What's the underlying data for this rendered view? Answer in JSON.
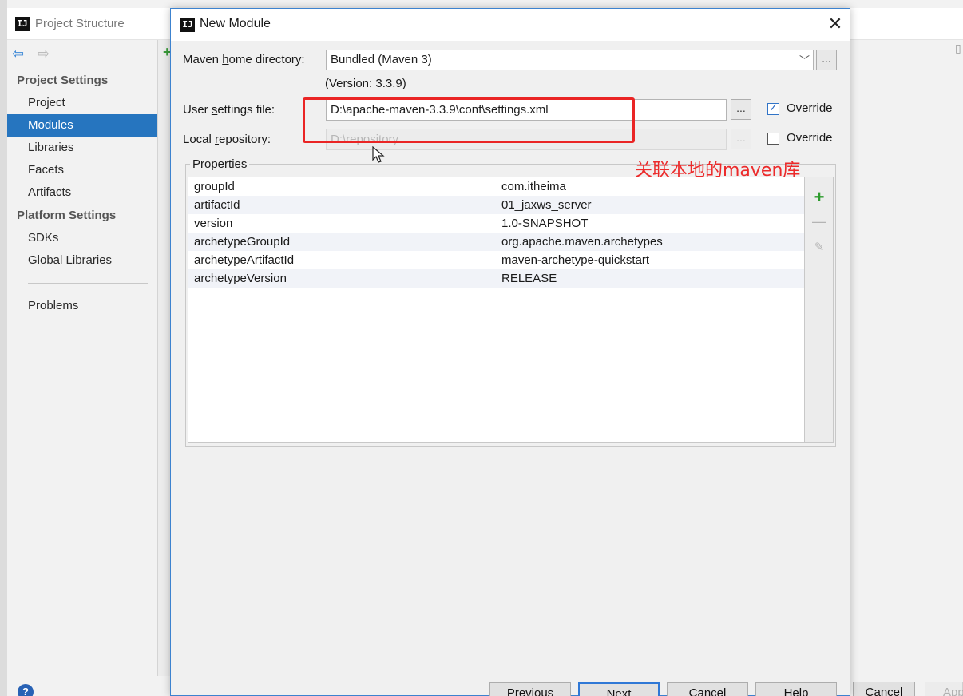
{
  "background_window": {
    "title": "Project Structure",
    "sidebar": {
      "section_project": "Project Settings",
      "project_items": [
        "Project",
        "Modules",
        "Libraries",
        "Facets",
        "Artifacts"
      ],
      "selected": "Modules",
      "section_platform": "Platform Settings",
      "platform_items": [
        "SDKs",
        "Global Libraries"
      ],
      "problems": "Problems"
    },
    "help_glyph": "?",
    "footer_buttons": {
      "cancel": "Cancel",
      "apply": "Apply"
    }
  },
  "dialog": {
    "title": "New Module",
    "maven_home": {
      "label_pre": "Maven ",
      "label_mnemonic": "h",
      "label_post": "ome directory:",
      "value": "Bundled (Maven 3)",
      "version_note": "(Version: 3.3.9)"
    },
    "user_settings": {
      "label_pre": "User ",
      "label_mnemonic": "s",
      "label_post": "ettings file:",
      "value": "D:\\apache-maven-3.3.9\\conf\\settings.xml",
      "override_label": "Override",
      "override_checked": true
    },
    "local_repository": {
      "label_pre": "Local ",
      "label_mnemonic": "r",
      "label_post": "epository:",
      "value": "D:\\repository",
      "override_label": "Override",
      "override_checked": false
    },
    "browse_label": "...",
    "properties": {
      "title": "Properties",
      "rows": [
        {
          "key": "groupId",
          "value": "com.itheima"
        },
        {
          "key": "artifactId",
          "value": "01_jaxws_server"
        },
        {
          "key": "version",
          "value": "1.0-SNAPSHOT"
        },
        {
          "key": "archetypeGroupId",
          "value": "org.apache.maven.archetypes"
        },
        {
          "key": "archetypeArtifactId",
          "value": "maven-archetype-quickstart"
        },
        {
          "key": "archetypeVersion",
          "value": "RELEASE"
        }
      ],
      "tools": {
        "add": "+",
        "remove": "—",
        "edit": "✎"
      }
    },
    "annotation_text": "关联本地的maven库",
    "buttons": {
      "previous": "Previous",
      "next": "Next",
      "cancel": "Cancel",
      "help": "Help"
    }
  },
  "colors": {
    "accent": "#2675bf",
    "annotation_red": "#ea2525",
    "add_green": "#2d9b2d"
  }
}
